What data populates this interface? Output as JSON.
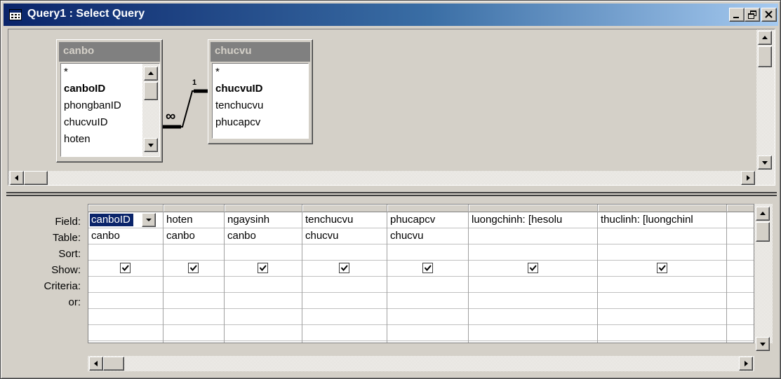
{
  "window": {
    "title": "Query1 : Select Query",
    "icon": "query-grid-icon",
    "controls": [
      "minimize-icon",
      "restore-icon",
      "close-icon"
    ]
  },
  "relationship": {
    "one_label": "1",
    "many_label": "∞"
  },
  "tables": [
    {
      "name": "canbo",
      "fields": [
        {
          "label": "*",
          "key": false
        },
        {
          "label": "canboID",
          "key": true
        },
        {
          "label": "phongbanID",
          "key": false
        },
        {
          "label": "chucvuID",
          "key": false
        },
        {
          "label": "hoten",
          "key": false
        }
      ]
    },
    {
      "name": "chucvu",
      "fields": [
        {
          "label": "*",
          "key": false
        },
        {
          "label": "chucvuID",
          "key": true
        },
        {
          "label": "tenchucvu",
          "key": false
        },
        {
          "label": "phucapcv",
          "key": false
        }
      ]
    }
  ],
  "grid": {
    "row_labels": [
      "Field:",
      "Table:",
      "Sort:",
      "Show:",
      "Criteria:",
      "or:"
    ],
    "columns": [
      {
        "field": "canboID",
        "table": "canbo",
        "show": true,
        "selected": true
      },
      {
        "field": "hoten",
        "table": "canbo",
        "show": true
      },
      {
        "field": "ngaysinh",
        "table": "canbo",
        "show": true
      },
      {
        "field": "tenchucvu",
        "table": "chucvu",
        "show": true
      },
      {
        "field": "phucapcv",
        "table": "chucvu",
        "show": true
      },
      {
        "field": "luongchinh: [hesolu",
        "table": "",
        "show": true
      },
      {
        "field": "thuclinh: [luongchinl",
        "table": "",
        "show": true
      },
      {
        "field": "",
        "table": "",
        "show": false
      }
    ]
  },
  "colors": {
    "titlebar_start": "#0a246a",
    "titlebar_end": "#a6caf0",
    "face": "#d4d0c8",
    "selection": "#0a246a"
  }
}
